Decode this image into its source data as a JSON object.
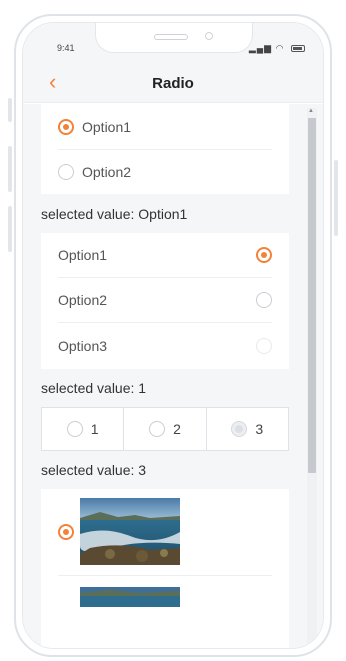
{
  "status": {
    "time": "9:41"
  },
  "nav": {
    "title": "Radio",
    "back_icon": "chevron-left-icon"
  },
  "colors": {
    "accent": "#f2823a",
    "background": "#f5f6f8"
  },
  "section1": {
    "options": [
      {
        "label": "Option1",
        "checked": true
      },
      {
        "label": "Option2",
        "checked": false
      }
    ],
    "selected_text": "selected value: Option1"
  },
  "section2": {
    "options": [
      {
        "label": "Option1",
        "checked": true
      },
      {
        "label": "Option2",
        "checked": false
      },
      {
        "label": "Option3",
        "checked": false,
        "disabled": true
      }
    ],
    "selected_text": "selected value: 1"
  },
  "section3": {
    "options": [
      {
        "label": "1",
        "checked": false
      },
      {
        "label": "2",
        "checked": false
      },
      {
        "label": "3",
        "checked": true,
        "disabled": true
      }
    ],
    "selected_text": "selected value: 3"
  },
  "section4": {
    "items": [
      {
        "image": "seascape-photo",
        "checked": true
      },
      {
        "image": "seascape-photo",
        "checked": false
      }
    ]
  }
}
